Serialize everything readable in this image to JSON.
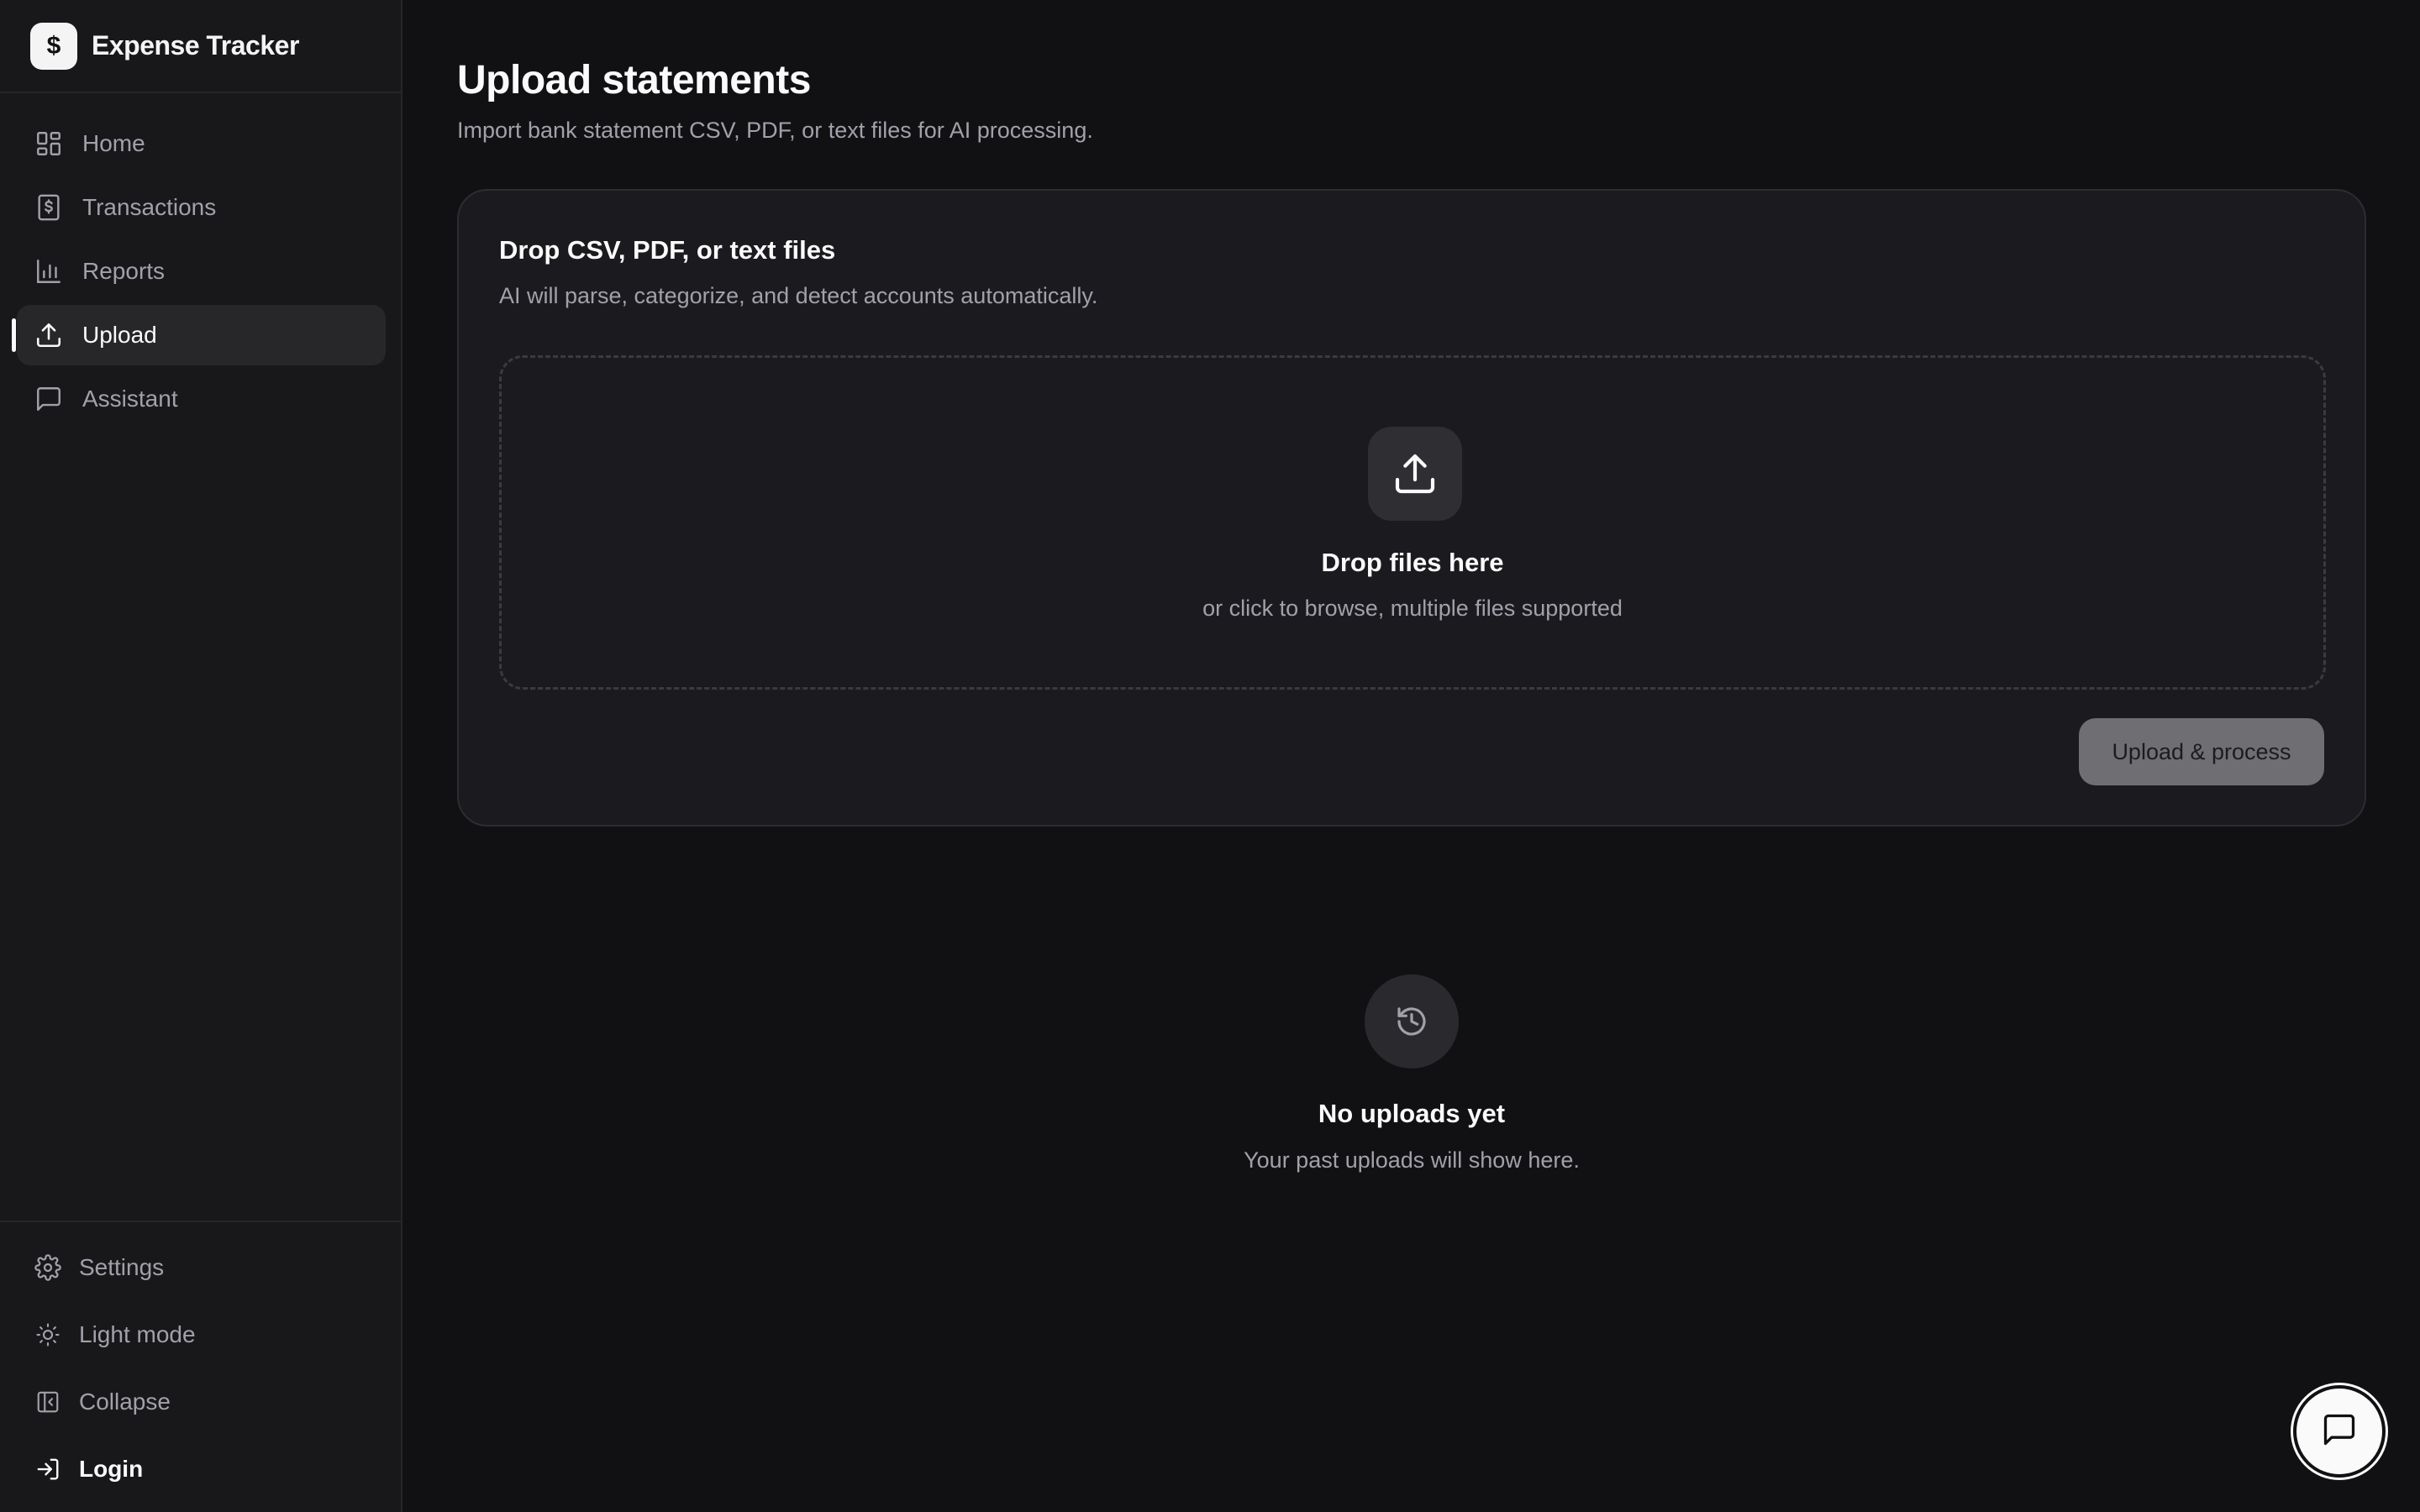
{
  "brand": {
    "logo_glyph": "$",
    "name": "Expense Tracker"
  },
  "sidebar": {
    "items": [
      {
        "label": "Home",
        "icon": "dashboard-grid-icon"
      },
      {
        "label": "Transactions",
        "icon": "receipt-dollar-icon"
      },
      {
        "label": "Reports",
        "icon": "bar-chart-icon"
      },
      {
        "label": "Upload",
        "icon": "upload-icon",
        "active": true
      },
      {
        "label": "Assistant",
        "icon": "message-square-icon"
      }
    ],
    "bottom": [
      {
        "label": "Settings",
        "icon": "gear-icon"
      },
      {
        "label": "Light mode",
        "icon": "sun-icon"
      },
      {
        "label": "Collapse",
        "icon": "panel-collapse-icon"
      },
      {
        "label": "Login",
        "icon": "login-icon"
      }
    ]
  },
  "page": {
    "title": "Upload statements",
    "subtitle": "Import bank statement CSV, PDF, or text files for AI processing."
  },
  "upload_card": {
    "title": "Drop CSV, PDF, or text files",
    "subtitle": "AI will parse, categorize, and detect accounts automatically.",
    "dropzone_title": "Drop files here",
    "dropzone_subtitle": "or click to browse, multiple files supported",
    "button_label": "Upload & process"
  },
  "history": {
    "empty_title": "No uploads yet",
    "empty_subtitle": "Your past uploads will show here."
  },
  "colors": {
    "background": "#111114",
    "sidebar": "#18181b",
    "card": "#1b1b1f",
    "text": "#fafafa",
    "muted": "#a1a1aa",
    "button_disabled": "#6e6e73"
  }
}
